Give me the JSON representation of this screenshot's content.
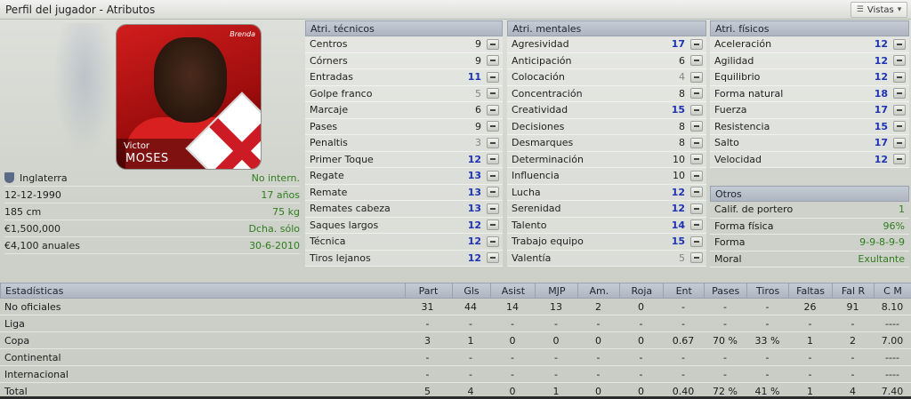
{
  "window": {
    "title": "Perfil del jugador - Atributos",
    "views_button": "Vistas"
  },
  "player": {
    "first_name": "Victor",
    "last_name": "MOSES",
    "brand": "Brenda",
    "nationality": "Inglaterra",
    "international_status": "No intern.",
    "dob": "12-12-1990",
    "age": "17 años",
    "height": "185 cm",
    "weight": "75 kg",
    "value": "€1,500,000",
    "foot": "Dcha. sólo",
    "wage": "€4,100 anuales",
    "contract_end": "30-6-2010"
  },
  "technical": {
    "title": "Atri. técnicos",
    "items": [
      {
        "name": "Centros",
        "value": "9",
        "tone": "mid"
      },
      {
        "name": "Córners",
        "value": "9",
        "tone": "mid"
      },
      {
        "name": "Entradas",
        "value": "11",
        "tone": "hi"
      },
      {
        "name": "Golpe franco",
        "value": "5",
        "tone": "lo"
      },
      {
        "name": "Marcaje",
        "value": "6",
        "tone": "mid"
      },
      {
        "name": "Pases",
        "value": "9",
        "tone": "mid"
      },
      {
        "name": "Penaltis",
        "value": "3",
        "tone": "lo"
      },
      {
        "name": "Primer Toque",
        "value": "12",
        "tone": "hi"
      },
      {
        "name": "Regate",
        "value": "13",
        "tone": "hi"
      },
      {
        "name": "Remate",
        "value": "13",
        "tone": "hi"
      },
      {
        "name": "Remates cabeza",
        "value": "13",
        "tone": "hi"
      },
      {
        "name": "Saques largos",
        "value": "12",
        "tone": "hi"
      },
      {
        "name": "Técnica",
        "value": "12",
        "tone": "hi"
      },
      {
        "name": "Tiros lejanos",
        "value": "12",
        "tone": "hi"
      }
    ]
  },
  "mental": {
    "title": "Atri. mentales",
    "items": [
      {
        "name": "Agresividad",
        "value": "17",
        "tone": "hi"
      },
      {
        "name": "Anticipación",
        "value": "6",
        "tone": "mid"
      },
      {
        "name": "Colocación",
        "value": "4",
        "tone": "lo"
      },
      {
        "name": "Concentración",
        "value": "8",
        "tone": "mid"
      },
      {
        "name": "Creatividad",
        "value": "15",
        "tone": "hi"
      },
      {
        "name": "Decisiones",
        "value": "8",
        "tone": "mid"
      },
      {
        "name": "Desmarques",
        "value": "8",
        "tone": "mid"
      },
      {
        "name": "Determinación",
        "value": "10",
        "tone": "mid"
      },
      {
        "name": "Influencia",
        "value": "10",
        "tone": "mid"
      },
      {
        "name": "Lucha",
        "value": "12",
        "tone": "hi"
      },
      {
        "name": "Serenidad",
        "value": "12",
        "tone": "hi"
      },
      {
        "name": "Talento",
        "value": "14",
        "tone": "hi"
      },
      {
        "name": "Trabajo equipo",
        "value": "15",
        "tone": "hi"
      },
      {
        "name": "Valentía",
        "value": "5",
        "tone": "lo"
      }
    ]
  },
  "physical": {
    "title": "Atri. físicos",
    "items": [
      {
        "name": "Aceleración",
        "value": "12",
        "tone": "hi"
      },
      {
        "name": "Agilidad",
        "value": "12",
        "tone": "hi"
      },
      {
        "name": "Equilibrio",
        "value": "12",
        "tone": "hi"
      },
      {
        "name": "Forma natural",
        "value": "18",
        "tone": "hi"
      },
      {
        "name": "Fuerza",
        "value": "17",
        "tone": "hi"
      },
      {
        "name": "Resistencia",
        "value": "15",
        "tone": "hi"
      },
      {
        "name": "Salto",
        "value": "17",
        "tone": "hi"
      },
      {
        "name": "Velocidad",
        "value": "12",
        "tone": "hi"
      }
    ]
  },
  "others": {
    "title": "Otros",
    "items": [
      {
        "name": "Calif. de portero",
        "value": "1"
      },
      {
        "name": "Forma física",
        "value": "96%"
      },
      {
        "name": "Forma",
        "value": "9-9-8-9-9"
      },
      {
        "name": "Moral",
        "value": "Exultante"
      }
    ]
  },
  "stats": {
    "headers": [
      "Estadísticas",
      "Part",
      "Gls",
      "Asist",
      "MJP",
      "Am.",
      "Roja",
      "Ent",
      "Pases",
      "Tiros",
      "Faltas",
      "Fal R",
      "C M"
    ],
    "rows": [
      [
        "No oficiales",
        "31",
        "44",
        "14",
        "13",
        "2",
        "0",
        "-",
        "-",
        "-",
        "26",
        "91",
        "8.10"
      ],
      [
        "Liga",
        "-",
        "-",
        "-",
        "-",
        "-",
        "-",
        "-",
        "-",
        "-",
        "-",
        "-",
        "----"
      ],
      [
        "Copa",
        "3",
        "1",
        "0",
        "0",
        "0",
        "0",
        "0.67",
        "70 %",
        "33 %",
        "1",
        "2",
        "7.00"
      ],
      [
        "Continental",
        "-",
        "-",
        "-",
        "-",
        "-",
        "-",
        "-",
        "-",
        "-",
        "-",
        "-",
        "----"
      ],
      [
        "Internacional",
        "-",
        "-",
        "-",
        "-",
        "-",
        "-",
        "-",
        "-",
        "-",
        "-",
        "-",
        "----"
      ],
      [
        "Total",
        "5",
        "4",
        "0",
        "1",
        "0",
        "0",
        "0.40",
        "72 %",
        "41 %",
        "1",
        "4",
        "7.40"
      ]
    ]
  },
  "colors": {
    "good": "#2f7d1d",
    "high": "#1d33b3",
    "low": "#858585",
    "header": "#b7bfc9"
  }
}
